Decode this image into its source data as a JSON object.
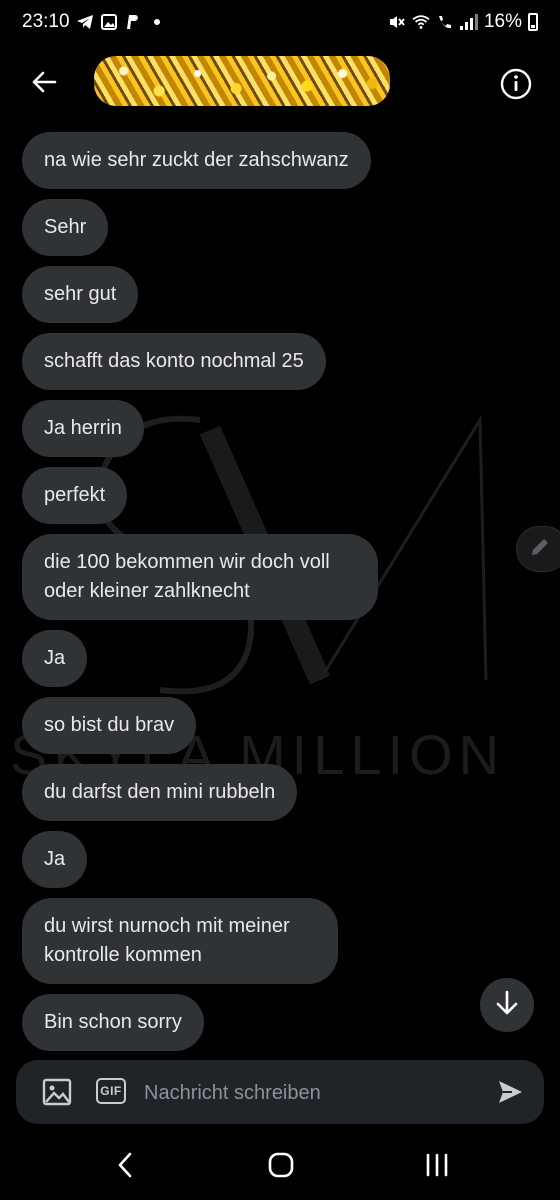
{
  "status_bar": {
    "time": "23:10",
    "battery": "16%",
    "left_icons": [
      "telegram-icon",
      "gallery-icon",
      "paypal-icon",
      "dot-icon"
    ],
    "right_icons": [
      "mute-icon",
      "wifi-icon",
      "call-icon",
      "signal-icon",
      "battery-icon"
    ]
  },
  "header": {
    "back_icon": "arrow-left-icon",
    "contact_name_redacted": true,
    "info_icon": "info-icon"
  },
  "watermark": {
    "monogram": "SM",
    "text": "SKYLA MILLION"
  },
  "messages": [
    {
      "text": "na wie sehr zuckt der zahschwanz"
    },
    {
      "text": "Sehr"
    },
    {
      "text": "sehr gut"
    },
    {
      "text": "schafft das konto nochmal 25"
    },
    {
      "text": "Ja herrin"
    },
    {
      "text": "perfekt"
    },
    {
      "text": "die 100 bekommen wir doch voll oder kleiner zahlknecht"
    },
    {
      "text": "Ja"
    },
    {
      "text": "so bist du brav"
    },
    {
      "text": "du darfst den mini rubbeln"
    },
    {
      "text": "Ja"
    },
    {
      "text": "du wirst nurnoch mit meiner kontrolle kommen"
    },
    {
      "text": "Bin schon sorry"
    }
  ],
  "composer": {
    "placeholder": "Nachricht schreiben",
    "gif_label": "GIF",
    "image_icon": "image-icon",
    "send_icon": "send-icon"
  },
  "fabs": {
    "edit_icon": "pencil-icon",
    "scroll_icon": "arrow-down-icon"
  },
  "navbar": {
    "back_icon": "chevron-left-icon",
    "home_icon": "home-icon",
    "recents_icon": "recents-icon"
  },
  "colors": {
    "background": "#000000",
    "bubble": "#2f3336",
    "text": "#e7e9ea"
  }
}
